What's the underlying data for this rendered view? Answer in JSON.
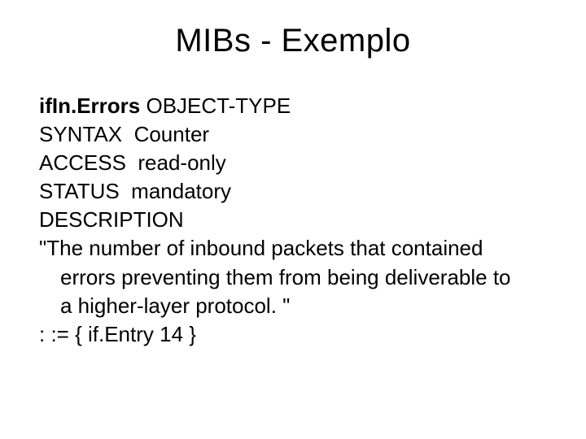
{
  "title": "MIBs - Exemplo",
  "mib": {
    "object_name": "ifIn.Errors",
    "object_keyword": "OBJECT-TYPE",
    "syntax_label": "SYNTAX",
    "syntax_value": "Counter",
    "access_label": "ACCESS",
    "access_value": "read-only",
    "status_label": "STATUS",
    "status_value": "mandatory",
    "description_label": "DESCRIPTION",
    "description_line1": "\"The number of inbound packets that contained",
    "description_line2": "errors preventing them from being deliverable to",
    "description_line3": "a higher-layer protocol. \"",
    "assignment": ": := { if.Entry 14 }"
  }
}
